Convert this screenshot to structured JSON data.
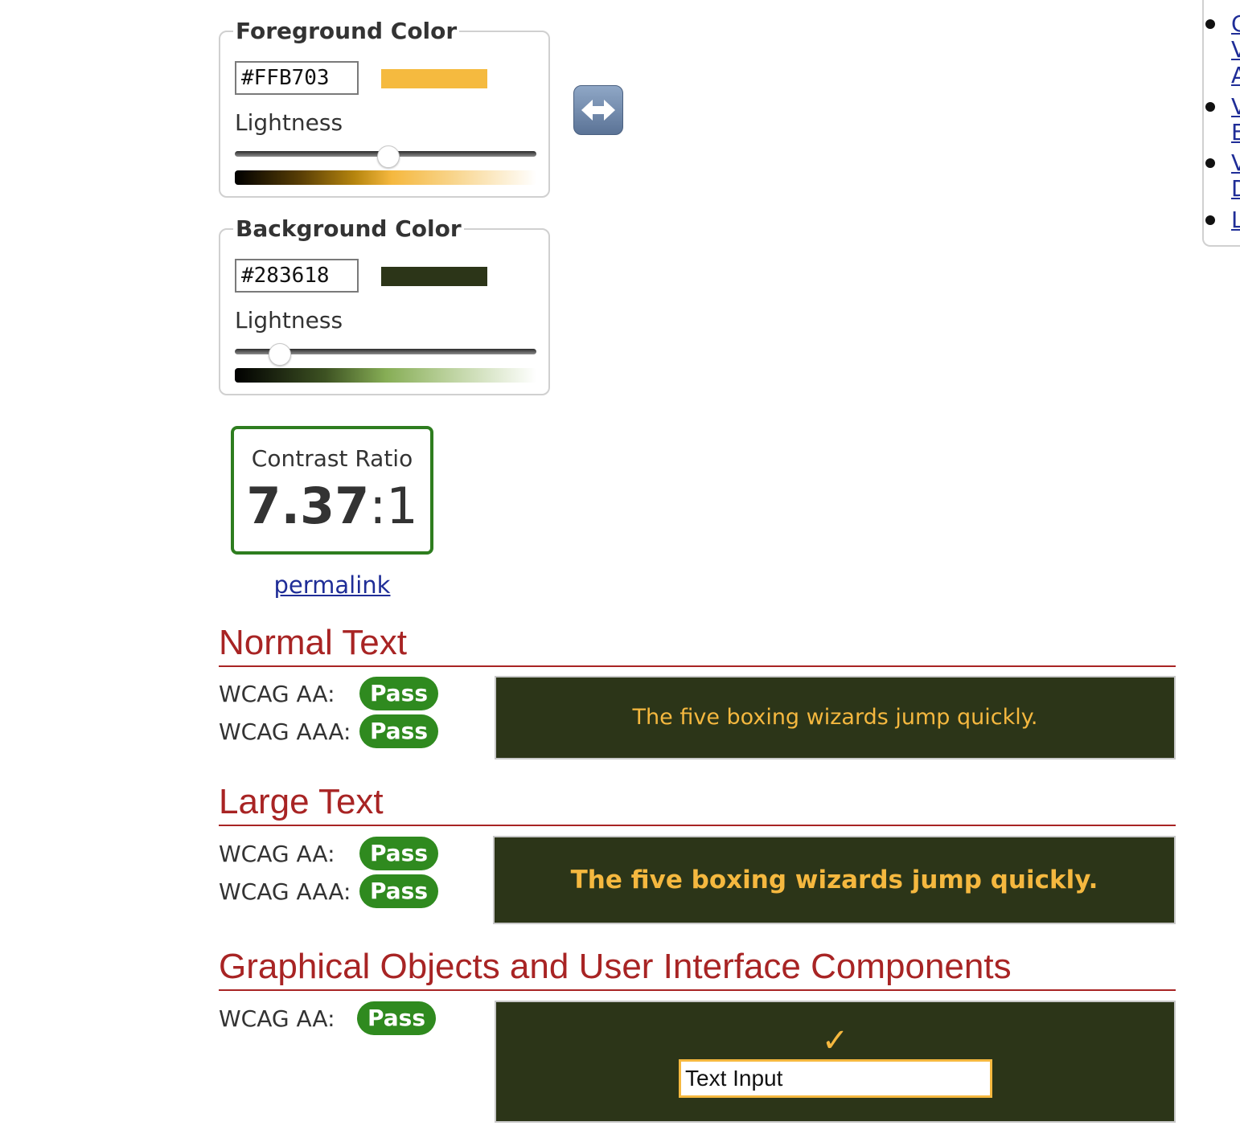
{
  "foreground": {
    "legend": "Foreground Color",
    "hex": "#FFB703",
    "swatch_color": "#F5BA3F",
    "lightness_label": "Lightness",
    "lightness_percent": 51
  },
  "background": {
    "legend": "Background Color",
    "hex": "#283618",
    "swatch_color": "#2C3518",
    "lightness_label": "Lightness",
    "lightness_percent": 15
  },
  "swap_icon": "left-right-arrow-icon",
  "contrast": {
    "label": "Contrast Ratio",
    "ratio_number": "7.37",
    "ratio_suffix": ":1",
    "permalink": "permalink"
  },
  "sections": {
    "normal": {
      "title": "Normal Text",
      "aa_label": "WCAG AA:",
      "aa_result": "Pass",
      "aaa_label": "WCAG AAA:",
      "aaa_result": "Pass",
      "sample": "The five boxing wizards jump quickly."
    },
    "large": {
      "title": "Large Text",
      "aa_label": "WCAG AA:",
      "aa_result": "Pass",
      "aaa_label": "WCAG AAA:",
      "aaa_result": "Pass",
      "sample": "The five boxing wizards jump quickly."
    },
    "graphical": {
      "title": "Graphical Objects and User Interface Components",
      "aa_label": "WCAG AA:",
      "aa_result": "Pass",
      "checkmark": "✓",
      "input_value": "Text Input"
    }
  },
  "sidebar_fragment": {
    "link_fragments": [
      "C",
      "V",
      "A",
      "V",
      "E",
      "V",
      "D",
      "L"
    ]
  },
  "colors": {
    "heading_red": "#A82424",
    "pass_green": "#2F8A1F",
    "ratio_border": "#2E7D1F",
    "link_blue": "#1F2D97",
    "sample_bg": "#2C3518",
    "sample_fg": "#F5B83F"
  }
}
